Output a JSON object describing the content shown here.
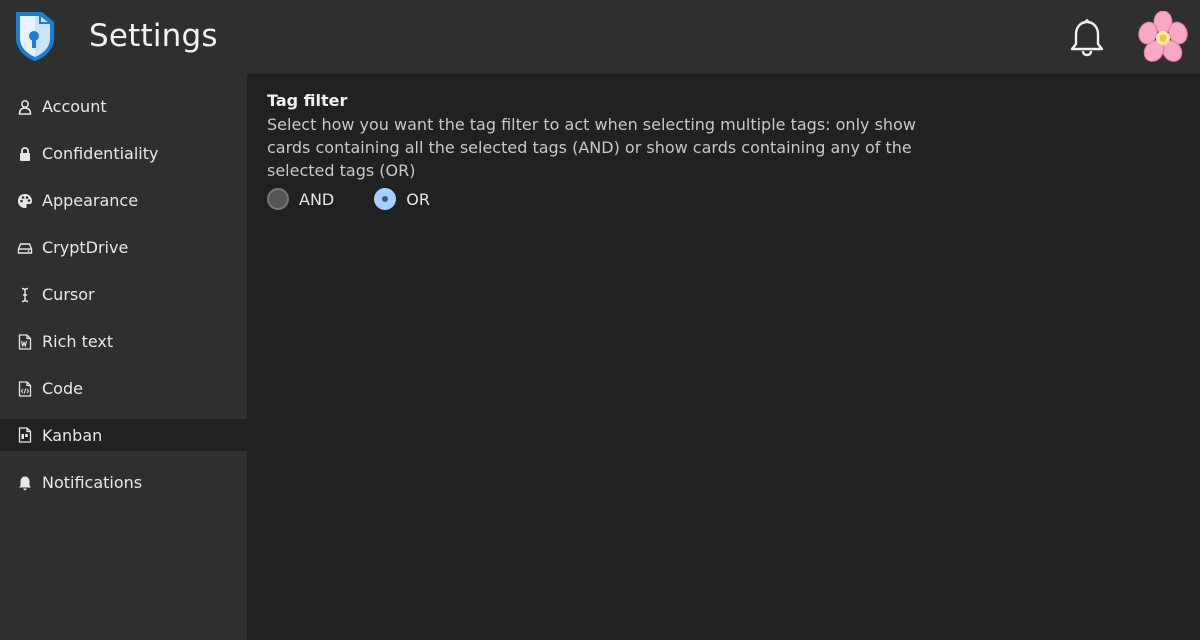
{
  "header": {
    "title": "Settings",
    "logo_icon": "cryptpad-shield-logo",
    "notifications_icon": "bell-icon",
    "avatar_icon": "cherry-blossom-avatar"
  },
  "sidebar": {
    "items": [
      {
        "label": "Account",
        "icon": "user-icon"
      },
      {
        "label": "Confidentiality",
        "icon": "lock-icon"
      },
      {
        "label": "Appearance",
        "icon": "palette-icon"
      },
      {
        "label": "CryptDrive",
        "icon": "drive-icon"
      },
      {
        "label": "Cursor",
        "icon": "text-cursor-icon"
      },
      {
        "label": "Rich text",
        "icon": "word-doc-icon"
      },
      {
        "label": "Code",
        "icon": "code-file-icon"
      },
      {
        "label": "Kanban",
        "icon": "kanban-icon"
      },
      {
        "label": "Notifications",
        "icon": "bell-icon"
      }
    ],
    "active": "Kanban"
  },
  "main": {
    "section_title": "Tag filter",
    "section_desc": "Select how you want the tag filter to act when selecting multiple tags: only show cards containing all the selected tags (AND) or show cards containing any of the selected tags (OR)",
    "options": [
      {
        "label": "AND",
        "checked": false
      },
      {
        "label": "OR",
        "checked": true
      }
    ]
  },
  "colors": {
    "background": "#212121",
    "panel": "#2f2f2f",
    "radio_checked": "#a8d0ff"
  }
}
